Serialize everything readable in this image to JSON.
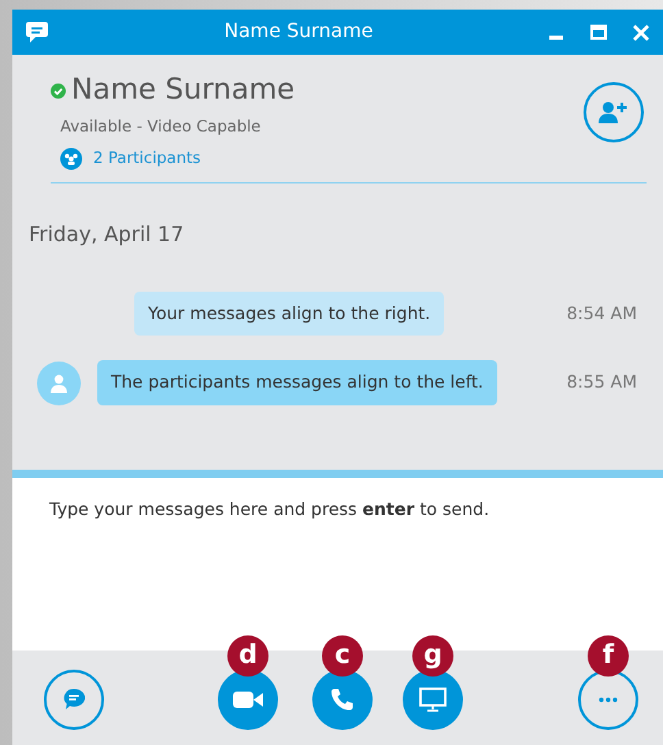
{
  "window": {
    "title": "Name Surname"
  },
  "contact": {
    "name": "Name Surname",
    "online": true,
    "status": "Available - Video Capable",
    "participants": "2 Participants"
  },
  "conversation": {
    "date": "Friday, April 17",
    "messages": [
      {
        "kind": "outgoing",
        "text": "Your messages align to the right.",
        "time": "8:54 AM"
      },
      {
        "kind": "incoming",
        "text": "The participants messages align to the left.",
        "time": "8:55 AM"
      }
    ]
  },
  "compose": {
    "prompt": "Type your messages here and press **enter** to send."
  },
  "toolbar": [
    {
      "kind": "chat"
    },
    {
      "kind": "video",
      "callout": "d"
    },
    {
      "kind": "phone",
      "callout": "c"
    },
    {
      "kind": "screen",
      "callout": "g"
    },
    {
      "kind": "more",
      "callout": "f"
    }
  ]
}
